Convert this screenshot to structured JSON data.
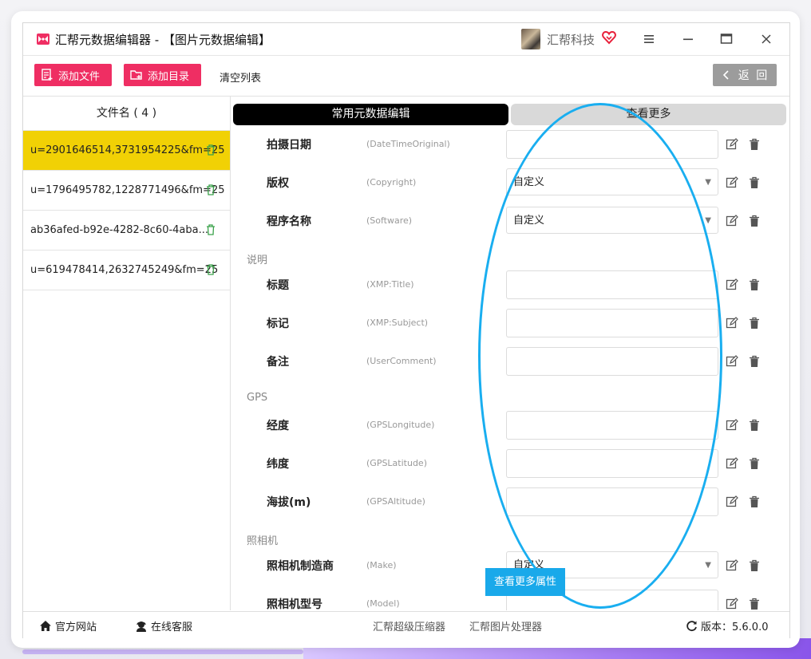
{
  "window": {
    "title": "汇帮元数据编辑器 - 【图片元数据编辑】",
    "brand": "汇帮科技",
    "accent": "#ef2e63"
  },
  "toolbar": {
    "add_file": "添加文件",
    "add_dir": "添加目录",
    "clear_list": "清空列表",
    "back": "返 回"
  },
  "file_list": {
    "header": "文件名 ( 4 )",
    "files": [
      {
        "name": "u=2901646514,3731954225&fm=25",
        "selected": true
      },
      {
        "name": "u=1796495782,1228771496&fm=25",
        "selected": false
      },
      {
        "name": "ab36afed-b92e-4282-8c60-4aba...",
        "selected": false
      },
      {
        "name": "u=619478414,2632745249&fm=25",
        "selected": false
      }
    ]
  },
  "tabs": {
    "common": "常用元数据编辑",
    "more": "查看更多"
  },
  "fields": {
    "date": {
      "label": "拍摄日期",
      "key": "(DateTimeOriginal)",
      "value": ""
    },
    "copyright": {
      "label": "版权",
      "key": "(Copyright)",
      "value": "自定义"
    },
    "software": {
      "label": "程序名称",
      "key": "(Software)",
      "value": "自定义"
    },
    "title": {
      "label": "标题",
      "key": "(XMP:Title)",
      "value": ""
    },
    "subject": {
      "label": "标记",
      "key": "(XMP:Subject)",
      "value": ""
    },
    "comment": {
      "label": "备注",
      "key": "(UserComment)",
      "value": ""
    },
    "longitude": {
      "label": "经度",
      "key": "(GPSLongitude)",
      "value": ""
    },
    "latitude": {
      "label": "纬度",
      "key": "(GPSLatitude)",
      "value": ""
    },
    "altitude": {
      "label": "海拔(m)",
      "key": "(GPSAltitude)",
      "value": ""
    },
    "make": {
      "label": "照相机制造商",
      "key": "(Make)",
      "value": "自定义"
    },
    "model": {
      "label": "照相机型号",
      "key": "(Model)",
      "value": ""
    }
  },
  "sections": {
    "description": "说明",
    "gps": "GPS",
    "camera": "照相机"
  },
  "tooltip": "查看更多属性",
  "statusbar": {
    "website": "官方网站",
    "service": "在线客服",
    "compressor": "汇帮超级压缩器",
    "image_tool": "汇帮图片处理器",
    "version": "版本：5.6.0.0"
  },
  "annotation_color": "#19aef0"
}
